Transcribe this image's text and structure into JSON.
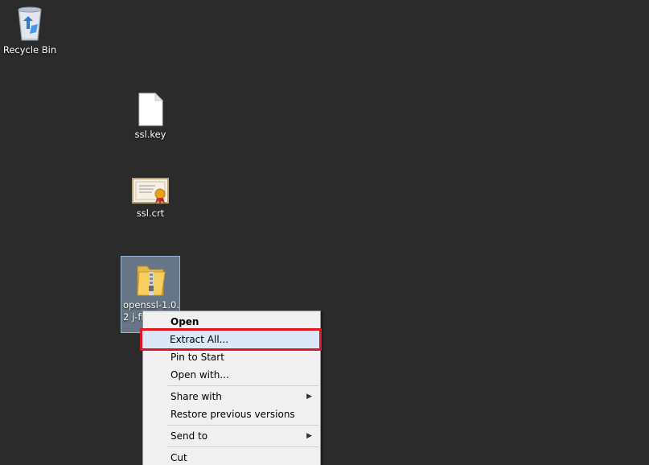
{
  "desktop": {
    "icons": [
      {
        "label": "Recycle Bin",
        "icon": "recycle-bin-icon"
      },
      {
        "label": "ssl.key",
        "icon": "blank-file-icon"
      },
      {
        "label": "ssl.crt",
        "icon": "certificate-icon"
      },
      {
        "label": "openssl-1.0.2j-fips",
        "label_visible": "openssl-1.0.2 j-fips",
        "icon": "zip-folder-icon"
      }
    ]
  },
  "context_menu": {
    "items": [
      {
        "label": "Open"
      },
      {
        "label": "Extract All..."
      },
      {
        "label": "Pin to Start"
      },
      {
        "label": "Open with..."
      },
      {
        "label": "Share with"
      },
      {
        "label": "Restore previous versions"
      },
      {
        "label": "Send to"
      },
      {
        "label": "Cut"
      }
    ],
    "highlight_color": "#e0151f"
  },
  "colors": {
    "desktop_bg": "#2b2b2b",
    "selection": "#99b4d1",
    "menu_bg": "#f0f0f0"
  }
}
